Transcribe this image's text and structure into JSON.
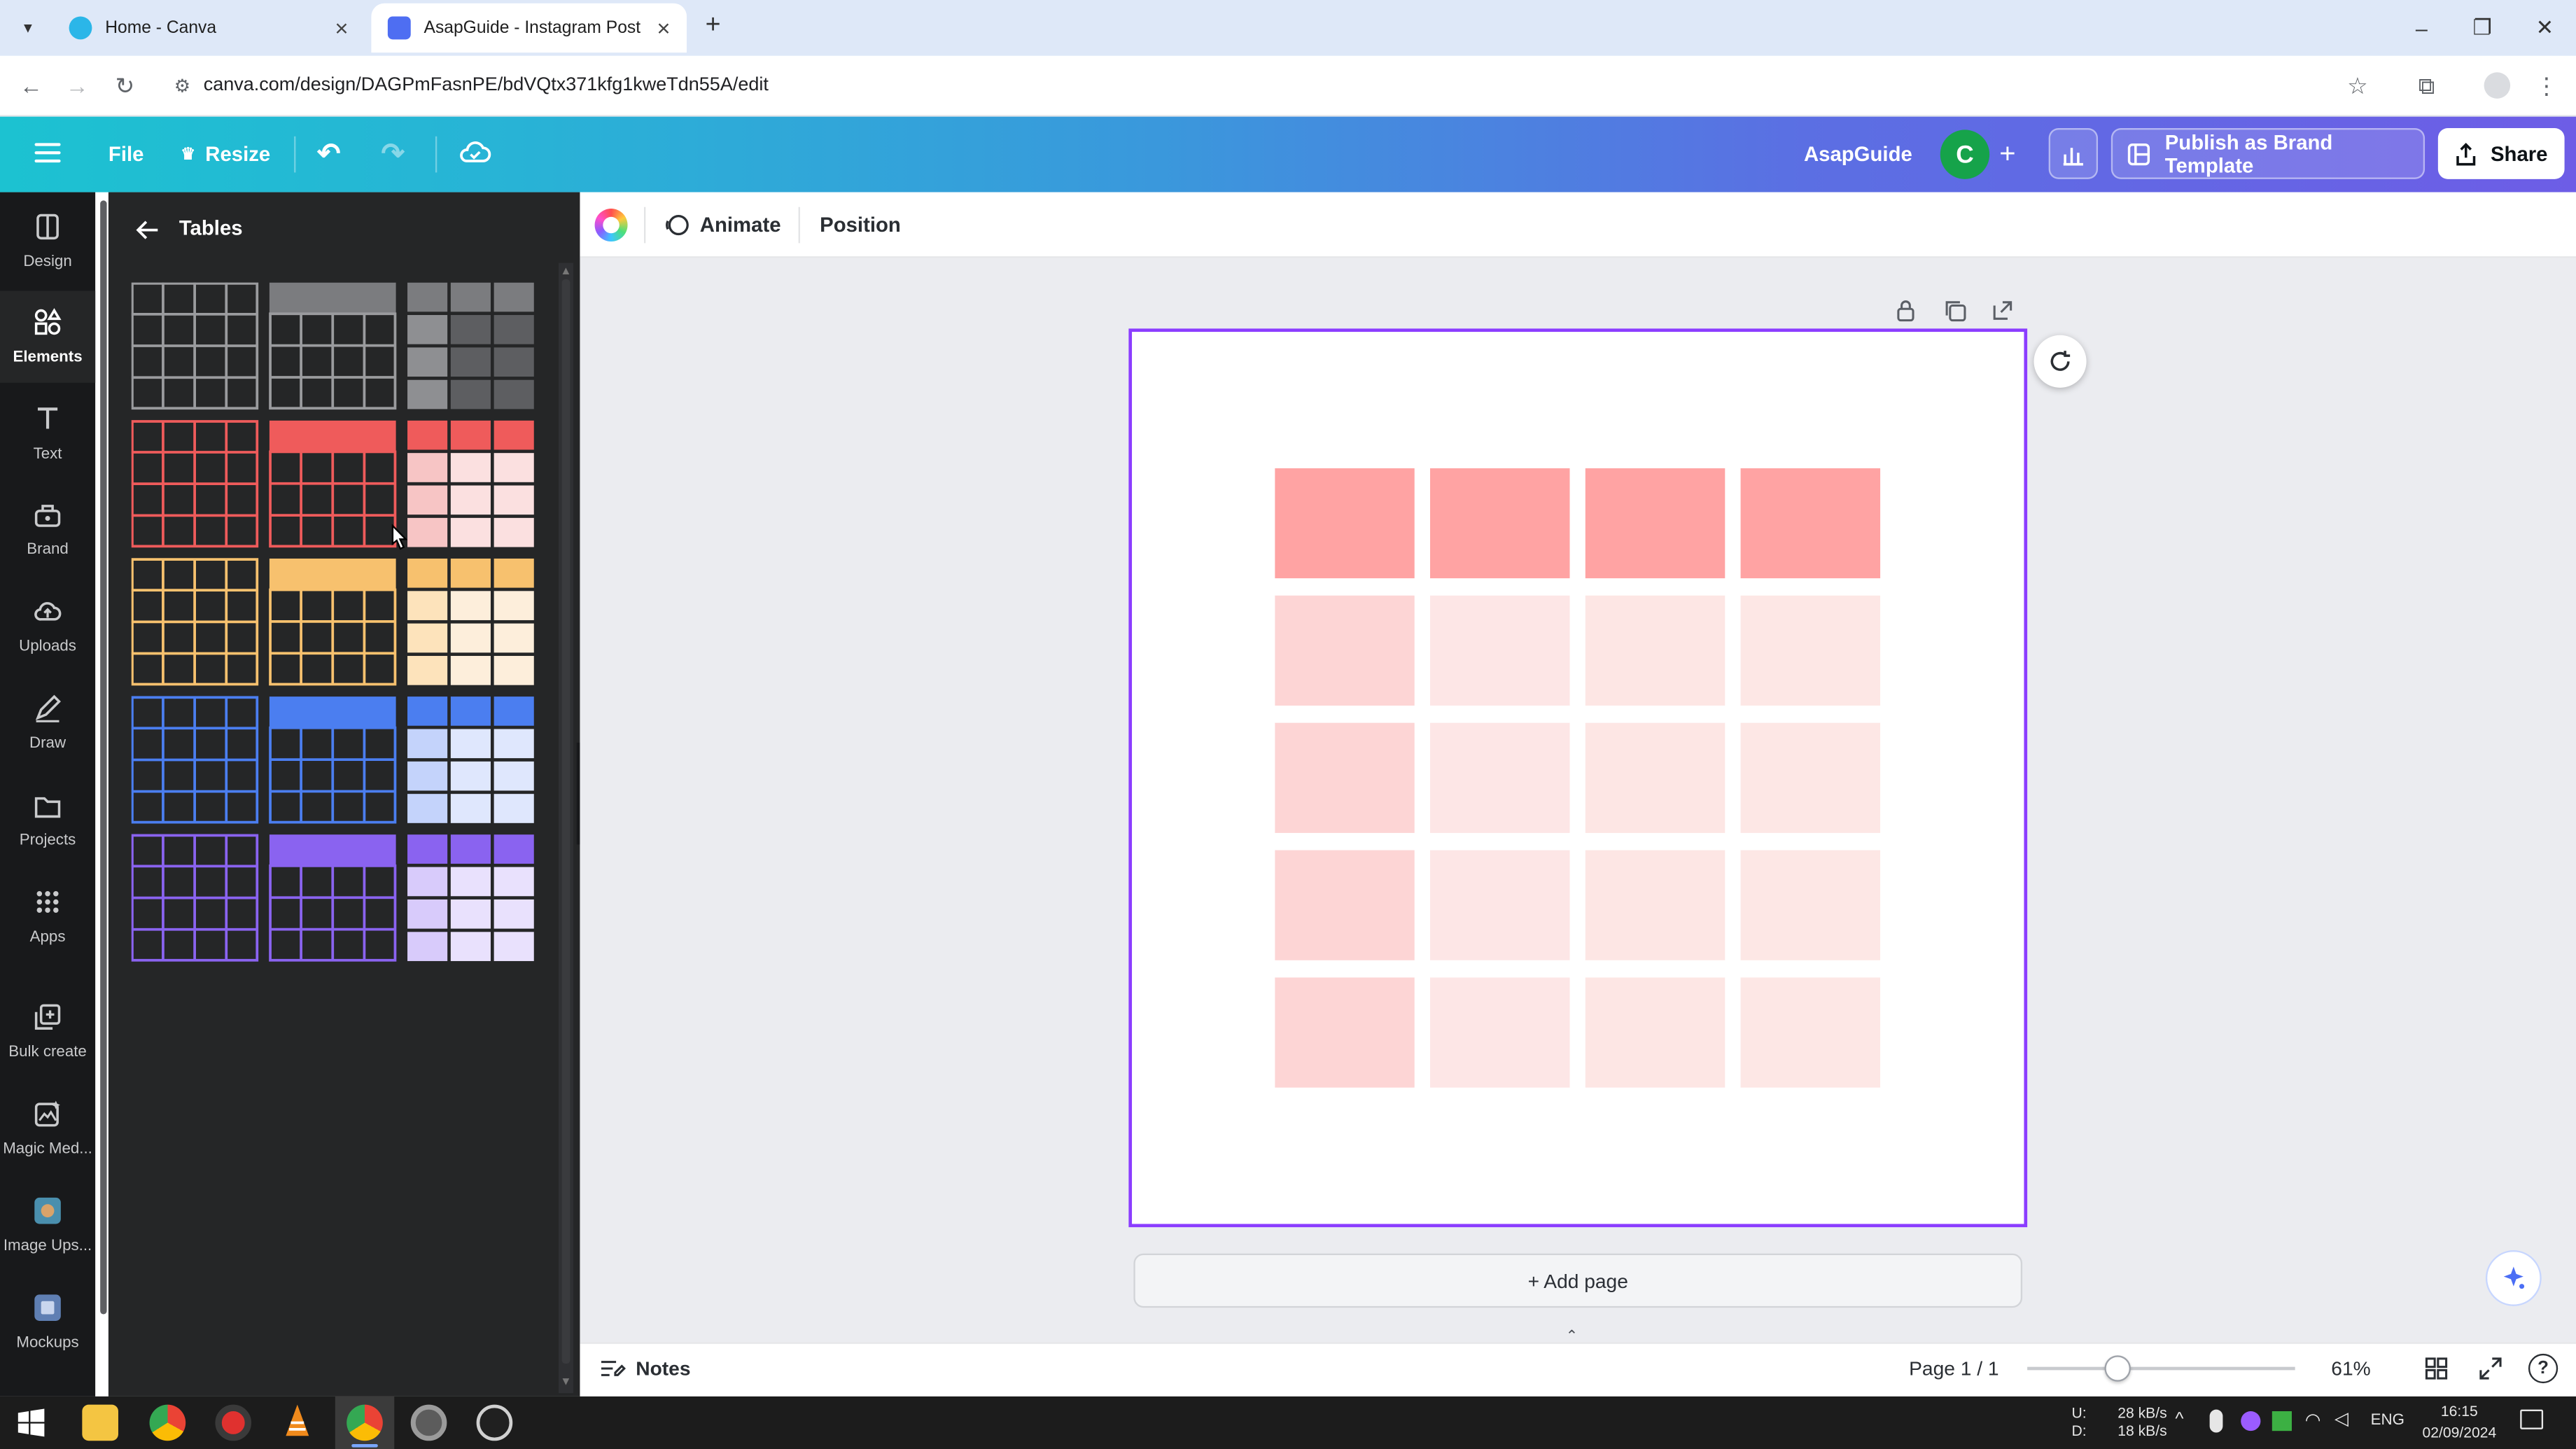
{
  "browser": {
    "tabs": [
      {
        "title": "Home - Canva",
        "active": false
      },
      {
        "title": "AsapGuide - Instagram Post",
        "active": true
      }
    ],
    "new_tab": "+",
    "url": "canva.com/design/DAGPmFasnPE/bdVQtx371kfg1kweTdn55A/edit"
  },
  "header": {
    "file": "File",
    "resize": "Resize",
    "team_name": "AsapGuide",
    "avatar_initial": "C",
    "publish_label": "Publish as Brand Template",
    "share_label": "Share"
  },
  "rail": {
    "items": [
      {
        "label": "Design",
        "icon": "design-icon"
      },
      {
        "label": "Elements",
        "icon": "elements-icon",
        "active": true
      },
      {
        "label": "Text",
        "icon": "text-icon"
      },
      {
        "label": "Brand",
        "icon": "brand-icon"
      },
      {
        "label": "Uploads",
        "icon": "uploads-icon"
      },
      {
        "label": "Draw",
        "icon": "draw-icon"
      },
      {
        "label": "Projects",
        "icon": "projects-icon"
      },
      {
        "label": "Apps",
        "icon": "apps-icon"
      },
      {
        "label": "Bulk create",
        "icon": "bulk-create-icon"
      },
      {
        "label": "Magic Med...",
        "icon": "magic-media-icon"
      },
      {
        "label": "Image Ups...",
        "icon": "image-upscaler-icon"
      },
      {
        "label": "Mockups",
        "icon": "mockups-icon"
      }
    ]
  },
  "panel": {
    "title": "Tables",
    "color_rows": [
      {
        "name": "gray",
        "line": "#9a9b9e",
        "head": "#7b7c7f",
        "body_light": "#8e8f92",
        "body_dark": "#5d5e61"
      },
      {
        "name": "red",
        "line": "#ef5b5b",
        "head": "#ef5b5b",
        "body_light": "#f7c5c5",
        "body_dark": "#fbe0e0"
      },
      {
        "name": "orange",
        "line": "#f7c16e",
        "head": "#f7c16e",
        "body_light": "#fde3bb",
        "body_dark": "#fdeedb"
      },
      {
        "name": "blue",
        "line": "#4b7ef0",
        "head": "#4b7ef0",
        "body_light": "#c4d3fb",
        "body_dark": "#dfe7fd"
      },
      {
        "name": "purple",
        "line": "#8a63f0",
        "head": "#8a63f0",
        "body_light": "#d8cbfb",
        "body_dark": "#e9e1fd"
      }
    ]
  },
  "toolbar": {
    "animate": "Animate",
    "position": "Position"
  },
  "canvas": {
    "table": {
      "rows": 5,
      "cols": 4,
      "header_color": "#ffa3a3",
      "body_colors": [
        "#fdd5d5",
        "#fde6e6",
        "#fde6e4",
        "#fde7e5"
      ]
    },
    "add_page": "+ Add page"
  },
  "footer": {
    "notes": "Notes",
    "page_indicator": "Page 1 / 1",
    "zoom": "61%",
    "zoom_level": 0.61
  },
  "taskbar": {
    "net_up_label": "U:",
    "net_down_label": "D:",
    "net_up": "28 kB/s",
    "net_down": "18 kB/s",
    "language": "ENG",
    "time": "16:15",
    "date": "02/09/2024"
  },
  "colors": {
    "brand_purple": "#8b3dff",
    "rail_bg": "#18191b",
    "panel_bg": "#252627",
    "canvas_bg": "#ebecf0",
    "avatar": "#16a34a"
  }
}
